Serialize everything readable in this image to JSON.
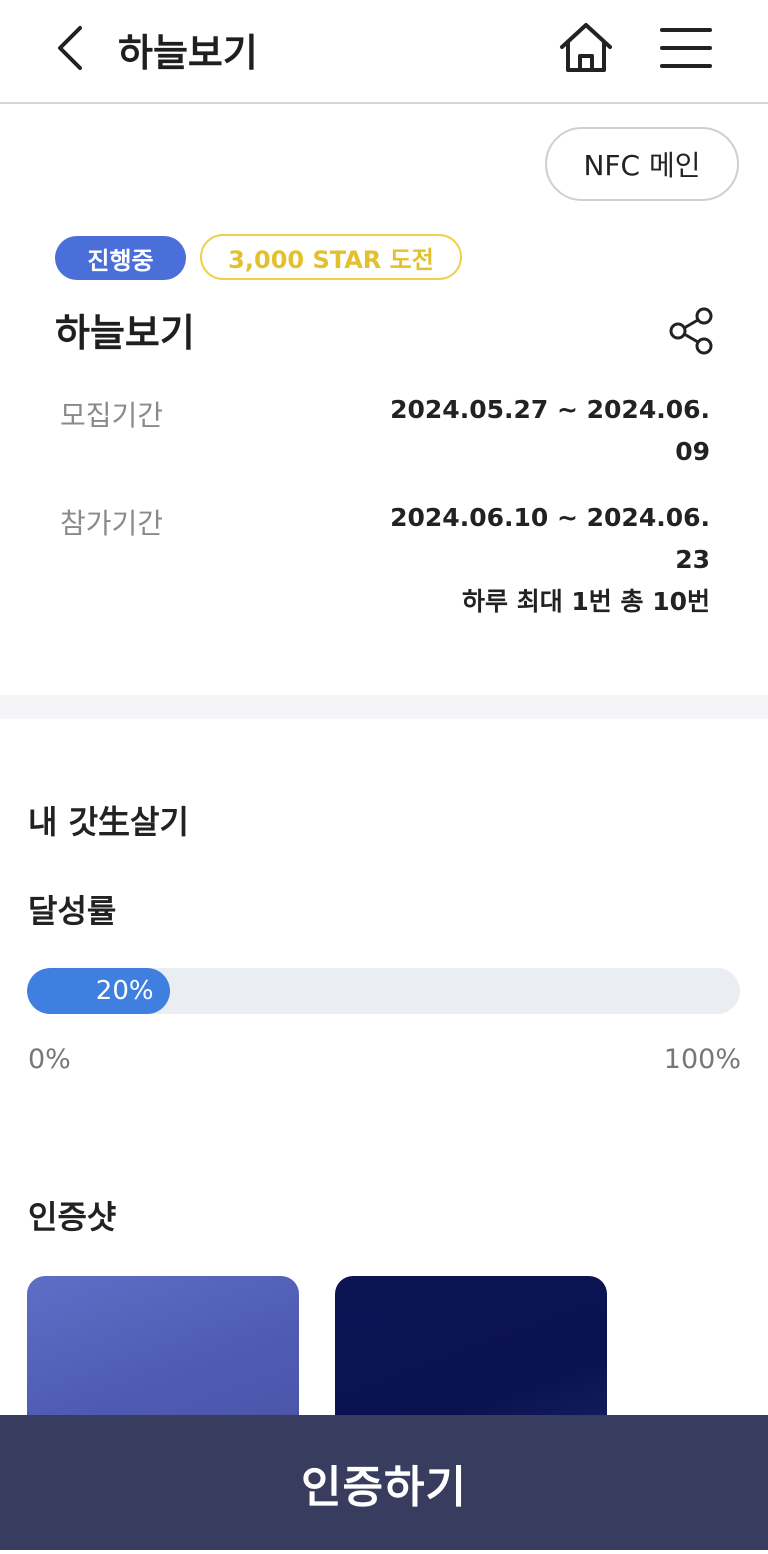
{
  "header": {
    "title": "하늘보기",
    "back_icon": "chevron-left-icon",
    "home_icon": "home-icon",
    "menu_icon": "hamburger-menu-icon"
  },
  "nfc_button": "NFC 메인",
  "badges": {
    "status": "진행중",
    "reward": "3,000 STAR 도전"
  },
  "challenge": {
    "title": "하늘보기",
    "share_icon": "share-icon",
    "recruit_label": "모집기간",
    "recruit_value": "2024.05.27 ~ 2024.06.09",
    "participate_label": "참가기간",
    "participate_value": "2024.06.10 ~ 2024.06.23",
    "frequency": "하루 최대 1번 총 10번"
  },
  "my_section": {
    "title": "내 갓生살기",
    "rate_title": "달성률",
    "progress_percent": 20,
    "progress_label": "20%",
    "min_label": "0%",
    "max_label": "100%"
  },
  "proof_section": {
    "title": "인증샷"
  },
  "cta": {
    "label": "인증하기"
  },
  "colors": {
    "primary": "#4a6fd8",
    "progress": "#3f7fe0",
    "reward": "#e3c12e",
    "cta_bg": "#383c5e"
  }
}
